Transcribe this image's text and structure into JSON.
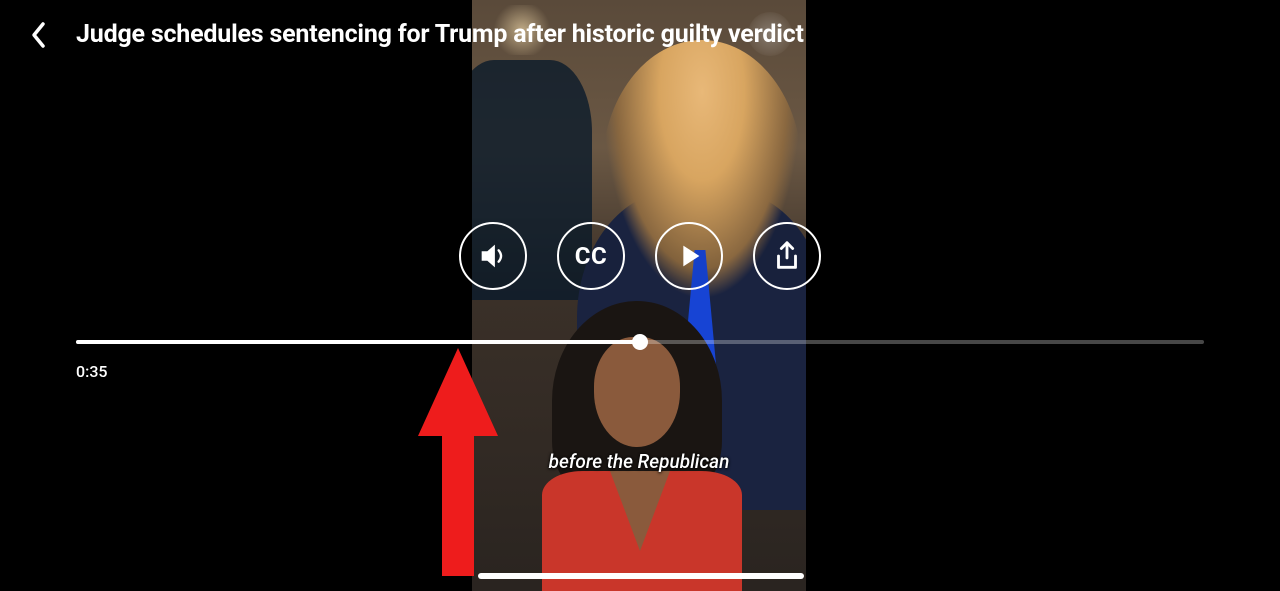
{
  "header": {
    "title": "Judge schedules sentencing for Trump after historic guilty verdict"
  },
  "video": {
    "caption": "before the Republican",
    "timestamp": "0:35",
    "progress_percent": 50
  },
  "controls": {
    "volume_icon": "volume-icon",
    "cc_label": "CC",
    "play_icon": "play-icon",
    "share_icon": "share-icon"
  }
}
